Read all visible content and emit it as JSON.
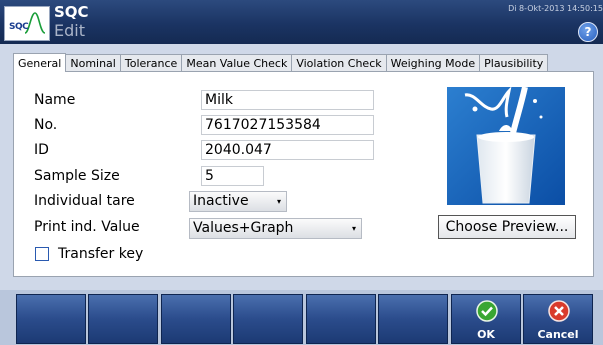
{
  "header": {
    "logo_text": "SQC",
    "title": "SQC",
    "subtitle": "Edit",
    "datetime": "Di 8-Okt-2013 14:50:15",
    "help_symbol": "?"
  },
  "tabs": [
    {
      "label": "General",
      "active": true
    },
    {
      "label": "Nominal",
      "active": false
    },
    {
      "label": "Tolerance",
      "active": false
    },
    {
      "label": "Mean Value Check",
      "active": false
    },
    {
      "label": "Violation Check",
      "active": false
    },
    {
      "label": "Weighing Mode",
      "active": false
    },
    {
      "label": "Plausibility",
      "active": false
    }
  ],
  "form": {
    "name_label": "Name",
    "name_value": "Milk",
    "no_label": "No.",
    "no_value": "7617027153584",
    "id_label": "ID",
    "id_value": "2040.047",
    "sample_size_label": "Sample Size",
    "sample_size_value": "5",
    "individual_tare_label": "Individual tare",
    "individual_tare_value": "Inactive",
    "print_label": "Print ind. Value",
    "print_value": "Values+Graph",
    "transfer_key_label": "Transfer key",
    "transfer_key_checked": false,
    "choose_preview_label": "Choose Preview..."
  },
  "bottombar": {
    "ok_label": "OK",
    "cancel_label": "Cancel",
    "ok_color": "#3aa632",
    "cancel_color": "#d93a2b"
  },
  "colors": {
    "header_bg": "#1b3463",
    "fkey_bg": "#2b4c8c",
    "panel_bg": "#ffffff"
  }
}
